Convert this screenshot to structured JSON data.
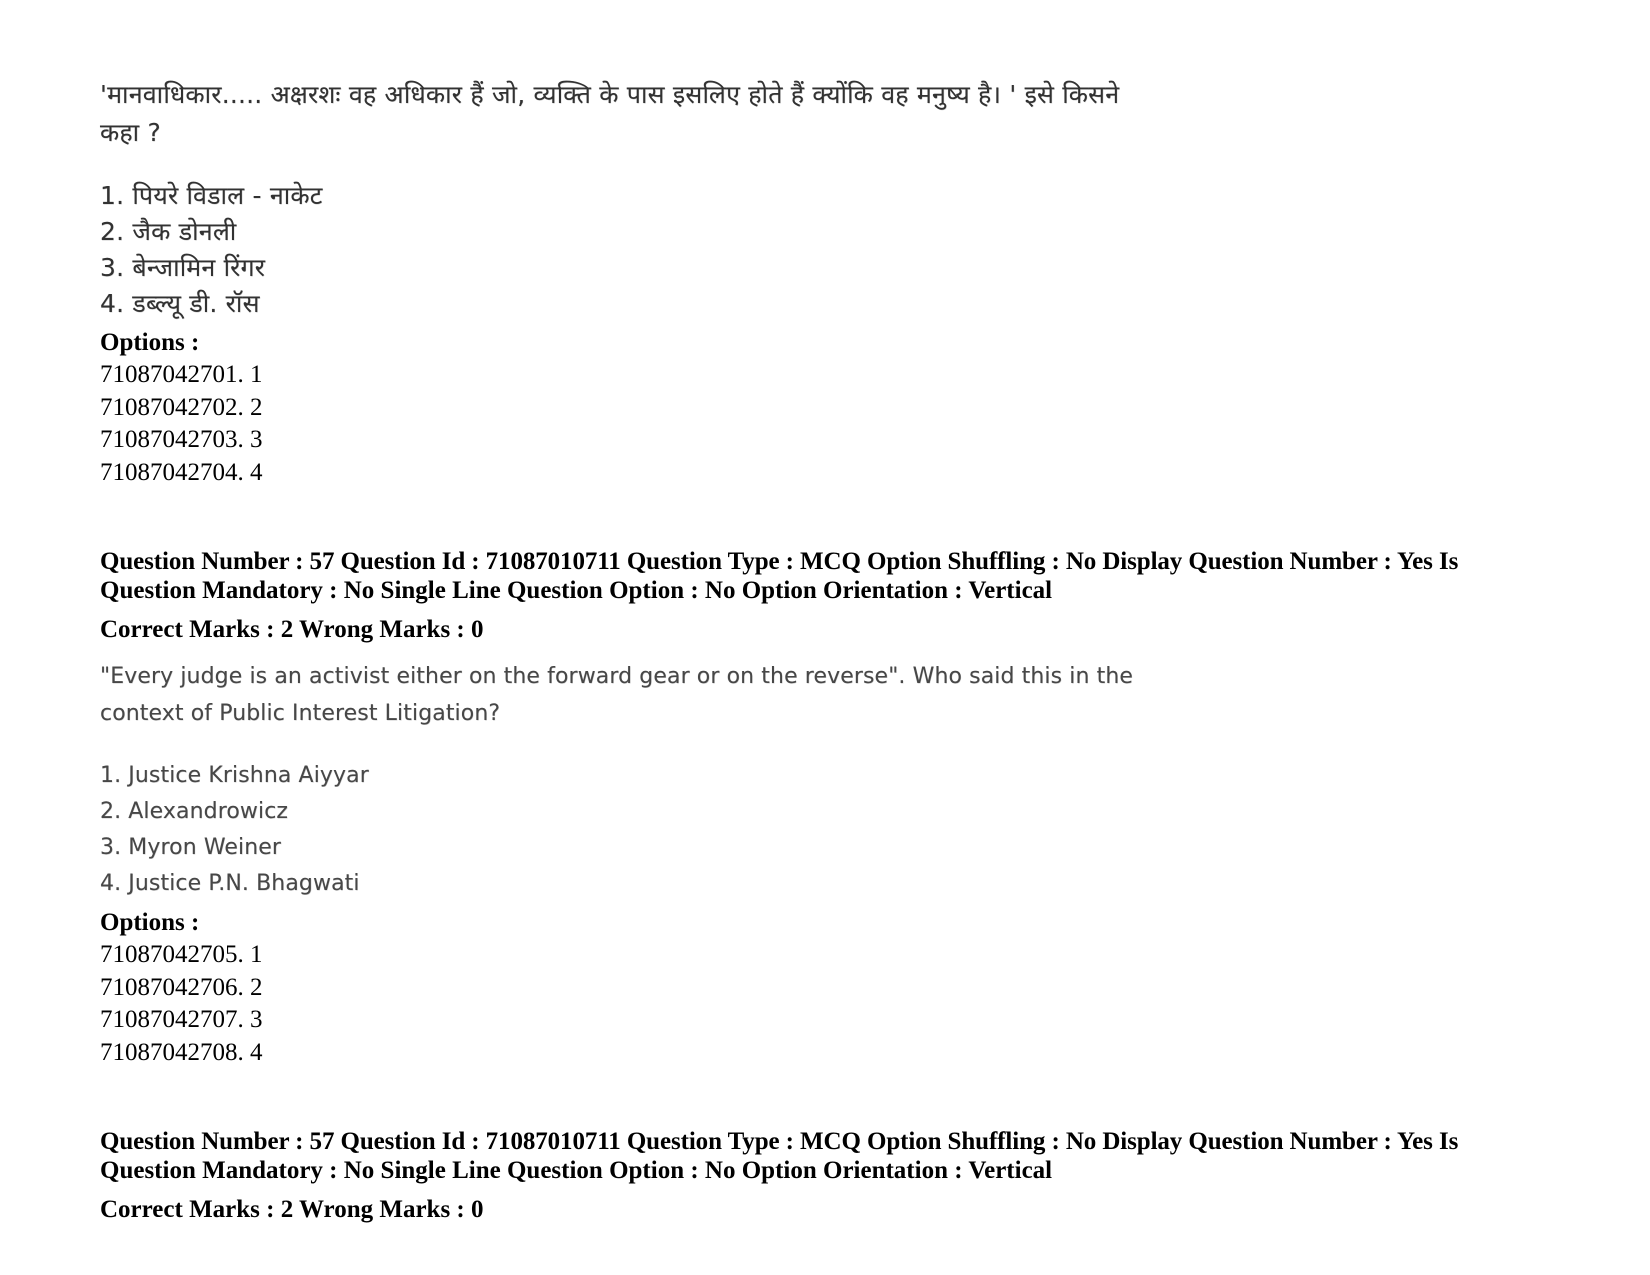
{
  "page": {
    "background_color": "#ffffff",
    "text_color": "#000000",
    "scanned_text_color": "#2b2b2b"
  },
  "question_hindi": {
    "stem_lines": [
      "'मानवाधिकार..... अक्षरशः वह अधिकार हैं जो, व्यक्ति के पास इसलिए होते हैं क्योंकि वह मनुष्य है। ' इसे किसने",
      "कहा ?"
    ],
    "choices": [
      "1. पियरे विडाल - नाकेट",
      "2. जैक डोनली",
      "3. बेन्जामिन रिंगर",
      "4. डब्ल्यू डी. रॉस"
    ],
    "options_label": "Options :",
    "option_ids": [
      "71087042701. 1",
      "71087042702. 2",
      "71087042703. 3",
      "71087042704. 4"
    ]
  },
  "question_meta_1": {
    "line1": "Question Number : 57 Question Id : 71087010711 Question Type : MCQ Option Shuffling : No Display Question Number : Yes Is",
    "line2": "Question Mandatory : No Single Line Question Option : No Option Orientation : Vertical",
    "line3": "Correct Marks : 2 Wrong Marks : 0",
    "question_number": "57",
    "question_id": "71087010711",
    "question_type": "MCQ",
    "option_shuffling": "No",
    "display_question_number": "Yes",
    "is_question_mandatory": "No",
    "single_line_question_option": "No",
    "option_orientation": "Vertical",
    "correct_marks": "2",
    "wrong_marks": "0"
  },
  "question_english": {
    "stem_lines": [
      "\"Every judge is an activist either on the forward gear or on the reverse\". Who said this in the",
      "context of Public Interest Litigation?"
    ],
    "choices": [
      "1. Justice Krishna Aiyyar",
      "2. Alexandrowicz",
      "3. Myron Weiner",
      "4. Justice P.N. Bhagwati"
    ],
    "options_label": "Options :",
    "option_ids": [
      "71087042705. 1",
      "71087042706. 2",
      "71087042707. 3",
      "71087042708. 4"
    ]
  },
  "question_meta_2": {
    "line1": "Question Number : 57 Question Id : 71087010711 Question Type : MCQ Option Shuffling : No Display Question Number : Yes Is",
    "line2": "Question Mandatory : No Single Line Question Option : No Option Orientation : Vertical",
    "line3": "Correct Marks : 2 Wrong Marks : 0",
    "question_number": "57",
    "question_id": "71087010711",
    "question_type": "MCQ",
    "option_shuffling": "No",
    "display_question_number": "Yes",
    "is_question_mandatory": "No",
    "single_line_question_option": "No",
    "option_orientation": "Vertical",
    "correct_marks": "2",
    "wrong_marks": "0"
  }
}
